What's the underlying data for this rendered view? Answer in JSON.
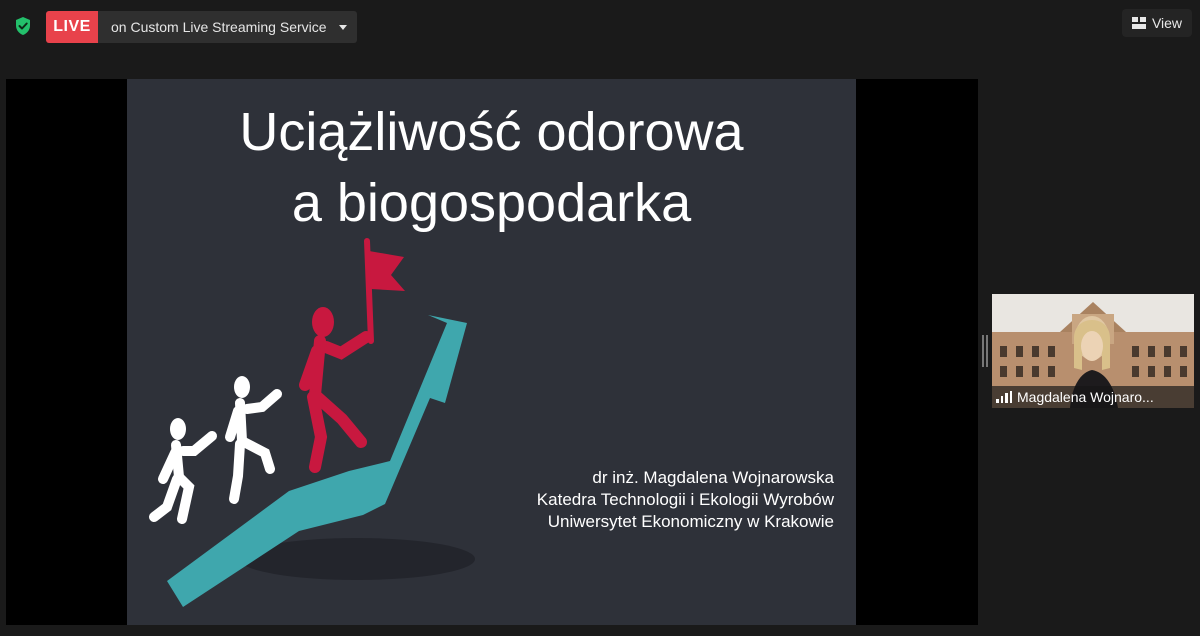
{
  "topbar": {
    "live_badge": "LIVE",
    "live_service": "on Custom Live Streaming Service",
    "view_label": "View",
    "security_icon": "shield-check-icon",
    "view_icon": "grid-icon"
  },
  "slide": {
    "title_line1": "Uciążliwość odorowa",
    "title_line2": "a biogospodarka",
    "author": "dr inż. Magdalena Wojnarowska",
    "department": "Katedra Technologii i Ekologii Wyrobów",
    "university": "Uniwersytet Ekonomiczny w Krakowie",
    "colors": {
      "background": "#2e3139",
      "arrow": "#3fa7ad",
      "leader": "#c8183f",
      "figures": "#ffffff"
    }
  },
  "participant": {
    "name": "Magdalena Wojnaro...",
    "signal_icon": "signal-bars-icon"
  },
  "colors": {
    "live": "#e8424b",
    "shield": "#23c06b"
  }
}
